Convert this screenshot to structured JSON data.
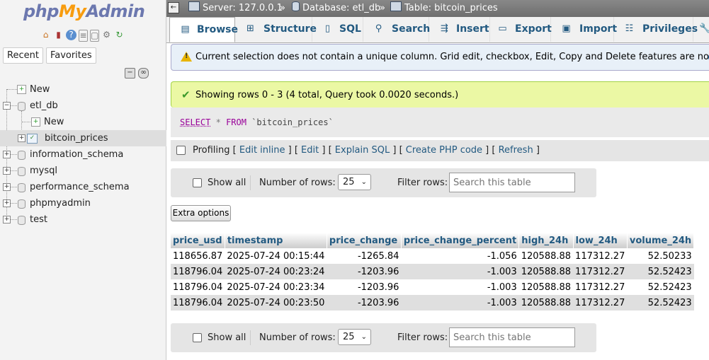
{
  "logo": {
    "php": "php",
    "my": "My",
    "admin": "Admin"
  },
  "nav_panel": {
    "recent_label": "Recent",
    "favorites_label": "Favorites",
    "tree": [
      {
        "label": "New",
        "type": "new"
      },
      {
        "label": "etl_db",
        "type": "db"
      },
      {
        "label": "New",
        "type": "new"
      },
      {
        "label": "bitcoin_prices",
        "type": "table"
      },
      {
        "label": "information_schema",
        "type": "db"
      },
      {
        "label": "mysql",
        "type": "db"
      },
      {
        "label": "performance_schema",
        "type": "db"
      },
      {
        "label": "phpmyadmin",
        "type": "db"
      },
      {
        "label": "test",
        "type": "db"
      }
    ]
  },
  "breadcrumb": {
    "server": "Server: 127.0.0.1",
    "database": "Database: etl_db",
    "table": "Table: bitcoin_prices",
    "separator": "»"
  },
  "tabs": [
    {
      "label": "Browse",
      "icon": "browse-icon"
    },
    {
      "label": "Structure",
      "icon": "structure-icon"
    },
    {
      "label": "SQL",
      "icon": "sql-icon"
    },
    {
      "label": "Search",
      "icon": "search-icon"
    },
    {
      "label": "Insert",
      "icon": "insert-icon"
    },
    {
      "label": "Export",
      "icon": "export-icon"
    },
    {
      "label": "Import",
      "icon": "import-icon"
    },
    {
      "label": "Privileges",
      "icon": "privileges-icon"
    }
  ],
  "notice": "Current selection does not contain a unique column. Grid edit, checkbox, Edit, Copy and Delete features are not available.",
  "success": "Showing rows 0 - 3 (4 total, Query took 0.0020 seconds.)",
  "sql": {
    "select": "SELECT",
    "star": "*",
    "from": "FROM",
    "table": "`bitcoin_prices`"
  },
  "profiling": {
    "label": "Profiling",
    "links": [
      "Edit inline",
      "Edit",
      "Explain SQL",
      "Create PHP code",
      "Refresh"
    ]
  },
  "nav_controls": {
    "show_all": "Show all",
    "number_of_rows_label": "Number of rows:",
    "rows_value": "25",
    "filter_label": "Filter rows:",
    "filter_placeholder": "Search this table"
  },
  "extra_options": "Extra options",
  "table": {
    "columns": [
      "price_usd",
      "timestamp",
      "price_change",
      "price_change_percent",
      "high_24h",
      "low_24h",
      "volume_24h"
    ],
    "rows": [
      [
        "118656.87",
        "2025-07-24 00:15:44",
        "-1265.84",
        "-1.056",
        "120588.88",
        "117312.27",
        "52.50233"
      ],
      [
        "118796.04",
        "2025-07-24 00:23:24",
        "-1203.96",
        "-1.003",
        "120588.88",
        "117312.27",
        "52.52423"
      ],
      [
        "118796.04",
        "2025-07-24 00:23:34",
        "-1203.96",
        "-1.003",
        "120588.88",
        "117312.27",
        "52.52423"
      ],
      [
        "118796.04",
        "2025-07-24 00:23:50",
        "-1203.96",
        "-1.003",
        "120588.88",
        "117312.27",
        "52.52423"
      ]
    ]
  }
}
